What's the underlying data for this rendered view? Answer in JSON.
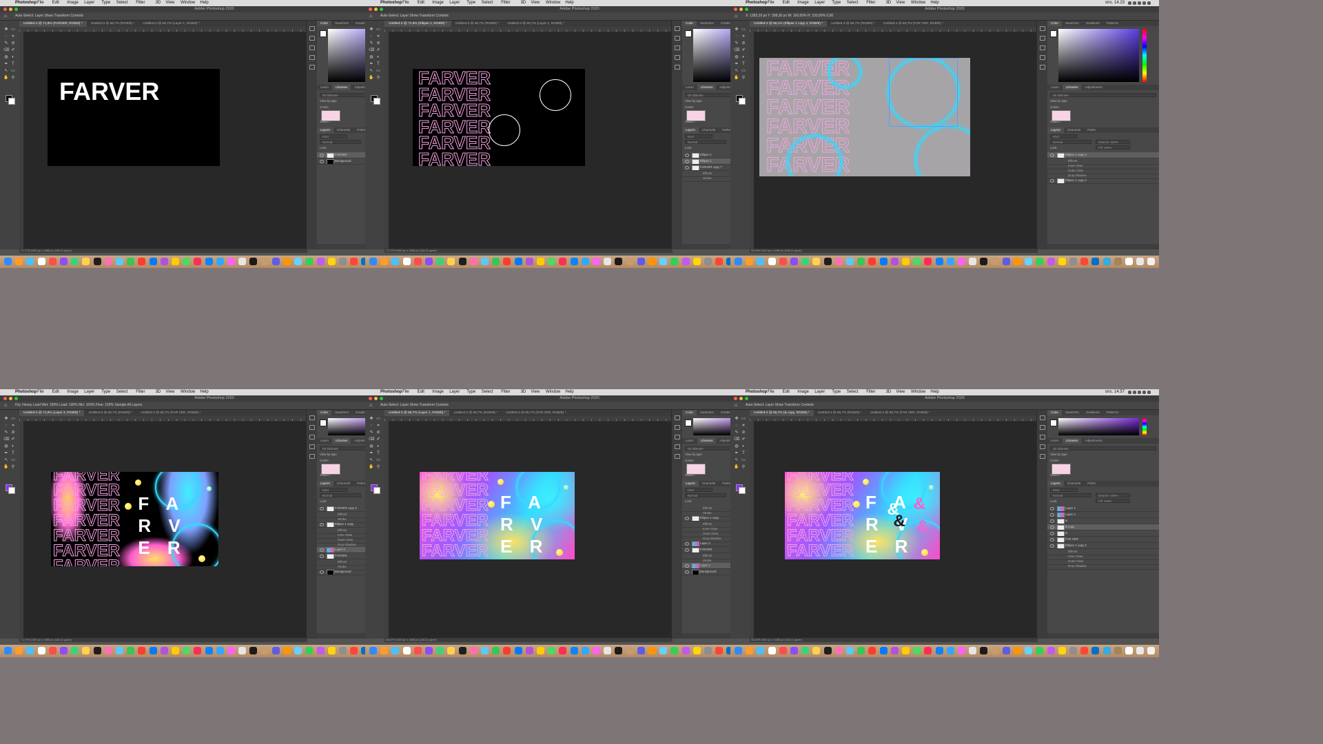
{
  "menu": {
    "app": "Photoshop",
    "items": [
      "File",
      "Edit",
      "Image",
      "Layer",
      "Type",
      "Select",
      "Filter",
      "3D",
      "View",
      "Window",
      "Help"
    ]
  },
  "window_title": "Adobe Photoshop 2020",
  "screenshots": [
    {
      "clock": "ons. 13.47",
      "options": "Auto-Select:   Layer      Show Transform Controls",
      "tabs": [
        "Untitled-2 @ 71,8% (FARVER, RGB/8) *",
        "Untitled-3 @ 66,7% (RGB/8) *",
        "Untitled-4 @ 66,7% (Layer 1, RGB/8) *"
      ],
      "status": "71,77%    1920 px x 1080 px (118,11 ppcm)",
      "layers": [
        {
          "name": "FARVER",
          "sel": true
        },
        {
          "name": "Background",
          "sel": false
        }
      ],
      "canvas_title": "FARVER"
    },
    {
      "clock": "ons. 13.55",
      "options": "Auto-Select:   Layer      Show Transform Controls",
      "tabs": [
        "Untitled-2 @ 71,8% (Ellipse 1, RGB/8) *",
        "Untitled-3 @ 66,7% (RGB/8) *",
        "Untitled-4 @ 66,7% (Layer 1, RGB/8) *"
      ],
      "status": "71,77%    1920 px x 1080 px (118,11 ppcm)",
      "layers": [
        {
          "name": "Ellipse 2",
          "sel": false
        },
        {
          "name": "Ellipse 1",
          "sel": true
        },
        {
          "name": "FARVER copy 7",
          "sel": false
        },
        {
          "name": "Effects",
          "sel": false,
          "sub": true
        },
        {
          "name": "Stroke",
          "sel": false,
          "sub": true
        }
      ],
      "canvas_title": "FARVER"
    },
    {
      "clock": "ons. 14.23",
      "options": "X: 1383,29 px   Y: 308,30 px   W: 100,00%   H: 100,00%   0,00",
      "tabs": [
        "Untitled-2 @ 66,1% (Ellipse 1 copy 4, RGB/8) *",
        "Untitled-3 @ 66,7% (RGB/8) *",
        "Untitled-4 @ 66,7% (FAR VER, RGB/8) *"
      ],
      "status": "66,06%    1920 px x 1080 px (118,11 ppcm)",
      "layers": [
        {
          "name": "Ellipse 1 copy 4",
          "sel": true
        },
        {
          "name": "Effects",
          "sel": false,
          "sub": true
        },
        {
          "name": "Inner Glow",
          "sel": false,
          "sub": true
        },
        {
          "name": "Outer Glow",
          "sel": false,
          "sub": true
        },
        {
          "name": "Drop Shadow",
          "sel": false,
          "sub": true
        },
        {
          "name": "Ellipse 1 copy 3",
          "sel": false
        }
      ],
      "canvas_title": "FARVER"
    },
    {
      "clock": "ons. 14.46",
      "options": "Dry, Heavy Load   Wet: 100%   Load: 100%   Mix: 100%   Flow: 100%   Sample All Layers",
      "tabs": [
        "Untitled-2 @ 71,8% (Layer 3, RGB/8) *",
        "Untitled-3 @ 66,7% (RGB/8) *",
        "Untitled-4 @ 66,7% (FAR VER, RGB/8) *"
      ],
      "status": "71,77%    1920 px x 1080 px (118,11 ppcm)",
      "layers": [
        {
          "name": "FARVER copy 3",
          "sel": false
        },
        {
          "name": "Effects",
          "sel": false,
          "sub": true
        },
        {
          "name": "Stroke",
          "sel": false,
          "sub": true
        },
        {
          "name": "Ellipse 1 copy",
          "sel": false
        },
        {
          "name": "Effects",
          "sel": false,
          "sub": true
        },
        {
          "name": "Inner Glow",
          "sel": false,
          "sub": true
        },
        {
          "name": "Outer Glow",
          "sel": false,
          "sub": true
        },
        {
          "name": "Drop Shadow",
          "sel": false,
          "sub": true
        },
        {
          "name": "Layer 3",
          "sel": true
        },
        {
          "name": "FARVER",
          "sel": false
        },
        {
          "name": "Effects",
          "sel": false,
          "sub": true
        },
        {
          "name": "Stroke",
          "sel": false,
          "sub": true
        },
        {
          "name": "Background",
          "sel": false
        }
      ],
      "canvas_title": "F A R V E R"
    },
    {
      "clock": "ons. 14.48",
      "options": "Auto-Select:   Layer      Show Transform Controls",
      "tabs": [
        "Untitled-2 @ 66,7% (Layer 1, RGB/8) *",
        "Untitled-3 @ 66,7% (RGB/8) *",
        "Untitled-4 @ 66,7% (FAR VER, RGB/8) *"
      ],
      "status": "66,67%    1920 px x 1080 px (118,11 ppcm)",
      "layers": [
        {
          "name": "Effects",
          "sel": false,
          "sub": true
        },
        {
          "name": "Stroke",
          "sel": false,
          "sub": true
        },
        {
          "name": "Ellipse 1 copy",
          "sel": false
        },
        {
          "name": "Effects",
          "sel": false,
          "sub": true
        },
        {
          "name": "Inner Glow",
          "sel": false,
          "sub": true
        },
        {
          "name": "Outer Glow",
          "sel": false,
          "sub": true
        },
        {
          "name": "Drop Shadow",
          "sel": false,
          "sub": true
        },
        {
          "name": "Layer 3",
          "sel": false
        },
        {
          "name": "FARVER",
          "sel": false
        },
        {
          "name": "Effects",
          "sel": false,
          "sub": true
        },
        {
          "name": "Stroke",
          "sel": false,
          "sub": true
        },
        {
          "name": "Layer 1",
          "sel": true
        },
        {
          "name": "Background",
          "sel": false
        }
      ],
      "canvas_title": "F A R V E R"
    },
    {
      "clock": "ons. 14.57",
      "options": "Auto-Select:   Layer      Show Transform Controls",
      "tabs": [
        "Untitled-2 @ 66,7% (& copy, RGB/8) *",
        "Untitled-3 @ 66,7% (RGB/8) *",
        "Untitled-4 @ 66,7% (FAR VER, RGB/8) *"
      ],
      "status": "66,67%    1920 px x 1080 px (118,11 ppcm)",
      "layers": [
        {
          "name": "Layer 4",
          "sel": false
        },
        {
          "name": "Layer 2",
          "sel": false
        },
        {
          "name": "&",
          "sel": false
        },
        {
          "name": "& copy",
          "sel": true
        },
        {
          "name": "&",
          "sel": false
        },
        {
          "name": "FAR VER",
          "sel": false
        },
        {
          "name": "Ellipse 1 copy 4",
          "sel": false
        },
        {
          "name": "Effects",
          "sel": false,
          "sub": true
        },
        {
          "name": "Inner Glow",
          "sel": false,
          "sub": true
        },
        {
          "name": "Outer Glow",
          "sel": false,
          "sub": true
        },
        {
          "name": "Drop Shadow",
          "sel": false,
          "sub": true
        }
      ],
      "canvas_title": "F A R V E R"
    }
  ],
  "panel": {
    "color_tabs": [
      "Color",
      "Swatches",
      "Gradients",
      "Patterns"
    ],
    "lib_tabs": [
      "Learn",
      "Libraries",
      "Adjustments"
    ],
    "layer_tabs": [
      "Layers",
      "Channels",
      "Paths"
    ],
    "library_select": "Dit bibliotek",
    "view_by": "View by type",
    "colors_label": "Colors",
    "swatch_label": "Swatch 1",
    "kind": "Kind",
    "blend": "Normal",
    "opacity": "Opacity: 100%",
    "lock": "Lock:",
    "fill": "Fill: 100%"
  },
  "ampersand": "&",
  "stack_word": "FARVER",
  "colors": {
    "accent_pink": "#f7a3e3",
    "neon_cyan": "#35d9ff",
    "desktop": "#7e7577"
  }
}
